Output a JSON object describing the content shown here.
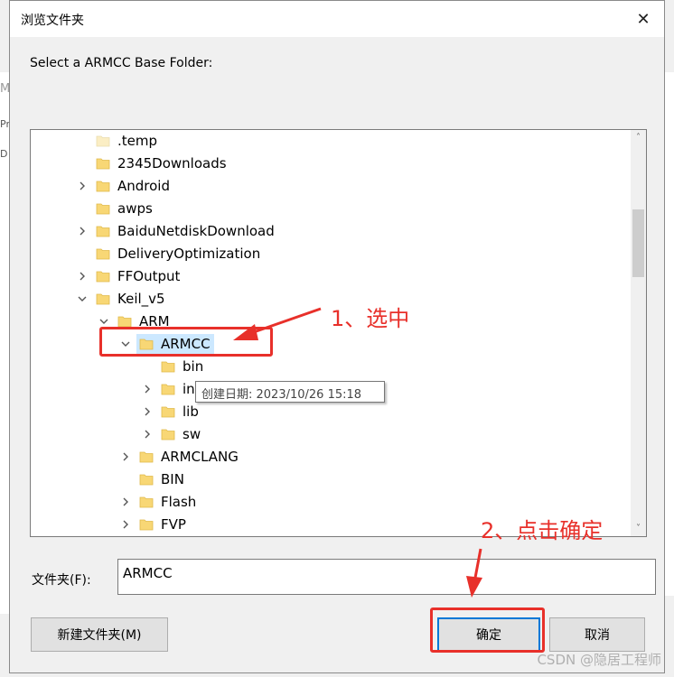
{
  "dialog": {
    "title": "浏览文件夹",
    "instruction": "Select a ARMCC Base Folder:",
    "folder_label": "文件夹(F):",
    "folder_value": "ARMCC",
    "new_folder_button": "新建文件夹(M)",
    "ok_button": "确定",
    "cancel_button": "取消"
  },
  "background_window": {
    "edge_texts": [
      "Ma",
      "Pr",
      "D"
    ]
  },
  "tree": {
    "items": [
      {
        "label": ".temp",
        "level": 0,
        "expander": "none",
        "icon": "folder-light"
      },
      {
        "label": "2345Downloads",
        "level": 0,
        "expander": "none",
        "icon": "folder"
      },
      {
        "label": "Android",
        "level": 0,
        "expander": "collapsed",
        "icon": "folder"
      },
      {
        "label": "awps",
        "level": 0,
        "expander": "none",
        "icon": "folder"
      },
      {
        "label": "BaiduNetdiskDownload",
        "level": 0,
        "expander": "collapsed",
        "icon": "folder"
      },
      {
        "label": "DeliveryOptimization",
        "level": 0,
        "expander": "none",
        "icon": "folder"
      },
      {
        "label": "FFOutput",
        "level": 0,
        "expander": "collapsed",
        "icon": "folder"
      },
      {
        "label": "Keil_v5",
        "level": 0,
        "expander": "expanded",
        "icon": "folder"
      },
      {
        "label": "ARM",
        "level": 1,
        "expander": "expanded",
        "icon": "folder"
      },
      {
        "label": "ARMCC",
        "level": 2,
        "expander": "expanded",
        "icon": "folder",
        "selected": true
      },
      {
        "label": "bin",
        "level": 3,
        "expander": "none",
        "icon": "folder"
      },
      {
        "label": "include",
        "level": 3,
        "expander": "collapsed",
        "icon": "folder"
      },
      {
        "label": "lib",
        "level": 3,
        "expander": "collapsed",
        "icon": "folder"
      },
      {
        "label": "sw",
        "level": 3,
        "expander": "collapsed",
        "icon": "folder"
      },
      {
        "label": "ARMCLANG",
        "level": 2,
        "expander": "collapsed",
        "icon": "folder"
      },
      {
        "label": "BIN",
        "level": 2,
        "expander": "none",
        "icon": "folder"
      },
      {
        "label": "Flash",
        "level": 2,
        "expander": "collapsed",
        "icon": "folder"
      },
      {
        "label": "FVP",
        "level": 2,
        "expander": "collapsed",
        "icon": "folder"
      }
    ]
  },
  "tooltip": "创建日期: 2023/10/26 15:18",
  "annotations": {
    "step1": "1、选中",
    "step2": "2、点击确定"
  },
  "watermark": "CSDN @隐居工程师",
  "colors": {
    "annotation_red": "#e8302a",
    "folder_yellow": "#f8d775",
    "selection_blue": "#cce8ff",
    "default_button_border": "#0078d7"
  }
}
